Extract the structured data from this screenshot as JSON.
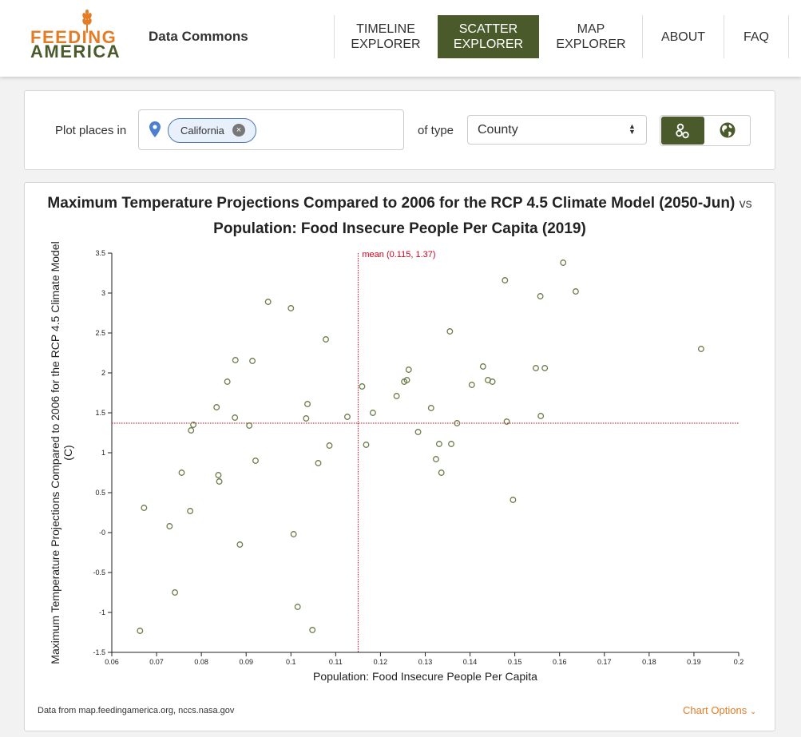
{
  "header": {
    "logo_top": "FEEDING",
    "logo_bottom": "AMERICA",
    "subtitle": "Data Commons",
    "nav": [
      {
        "line1": "TIMELINE",
        "line2": "EXPLORER"
      },
      {
        "line1": "SCATTER",
        "line2": "EXPLORER"
      },
      {
        "line1": "MAP",
        "line2": "EXPLORER"
      },
      {
        "line1": "ABOUT",
        "line2": ""
      },
      {
        "line1": "FAQ",
        "line2": ""
      }
    ],
    "active_nav": "SCATTER EXPLORER"
  },
  "filters": {
    "plot_label": "Plot places in",
    "place_chip": "California",
    "chip_close": "×",
    "type_label": "of type",
    "type_value": "County",
    "toggle_icons": [
      "scatter-icon",
      "globe-icon"
    ]
  },
  "chart_title": {
    "part1": "Maximum Temperature Projections Compared to 2006 for the RCP 4.5 Climate Model (2050-Jun)",
    "vs": "vs",
    "part2": "Population: Food Insecure People Per Capita (2019)"
  },
  "footer": {
    "source": "Data from map.feedingamerica.org, nccs.nasa.gov",
    "chart_options": "Chart Options"
  },
  "colors": {
    "brand_orange": "#e37c25",
    "brand_green": "#4a5a2b",
    "point": "#6b7d49",
    "mean_line": "#d0021b"
  },
  "chart_data": {
    "type": "scatter",
    "xlabel": "Population: Food Insecure People Per Capita",
    "ylabel": "Maximum Temperature Projections Compared to 2006 for the RCP 4.5 Climate Model (C)",
    "xlim": [
      0.06,
      0.2
    ],
    "ylim": [
      -1.5,
      3.5
    ],
    "x_ticks": [
      "0.06",
      "0.07",
      "0.08",
      "0.09",
      "0.1",
      "0.11",
      "0.12",
      "0.13",
      "0.14",
      "0.15",
      "0.16",
      "0.17",
      "0.18",
      "0.19",
      "0.2"
    ],
    "y_ticks": [
      "-1.5",
      "-1",
      "-0.5",
      "-0",
      "0.5",
      "1",
      "1.5",
      "2",
      "2.5",
      "3",
      "3.5"
    ],
    "mean": {
      "x": 0.115,
      "y": 1.37,
      "label": "mean (0.115, 1.37)"
    },
    "points": [
      [
        0.0663,
        -1.23
      ],
      [
        0.0672,
        0.31
      ],
      [
        0.0729,
        0.08
      ],
      [
        0.0741,
        -0.75
      ],
      [
        0.0756,
        0.75
      ],
      [
        0.0775,
        0.27
      ],
      [
        0.0777,
        1.28
      ],
      [
        0.0782,
        1.35
      ],
      [
        0.0834,
        1.57
      ],
      [
        0.0838,
        0.72
      ],
      [
        0.084,
        0.64
      ],
      [
        0.0858,
        1.89
      ],
      [
        0.0875,
        1.44
      ],
      [
        0.0876,
        2.16
      ],
      [
        0.0886,
        -0.15
      ],
      [
        0.0907,
        1.34
      ],
      [
        0.0914,
        2.15
      ],
      [
        0.0921,
        0.9
      ],
      [
        0.0949,
        2.89
      ],
      [
        0.1,
        2.81
      ],
      [
        0.1006,
        -0.02
      ],
      [
        0.1015,
        -0.93
      ],
      [
        0.1034,
        1.43
      ],
      [
        0.1037,
        1.61
      ],
      [
        0.1048,
        -1.22
      ],
      [
        0.1061,
        0.87
      ],
      [
        0.1078,
        2.42
      ],
      [
        0.1086,
        1.09
      ],
      [
        0.1126,
        1.45
      ],
      [
        0.1159,
        1.83
      ],
      [
        0.1168,
        1.1
      ],
      [
        0.1183,
        1.5
      ],
      [
        0.1236,
        1.71
      ],
      [
        0.1253,
        1.89
      ],
      [
        0.1259,
        1.91
      ],
      [
        0.1263,
        2.04
      ],
      [
        0.1284,
        1.26
      ],
      [
        0.1313,
        1.56
      ],
      [
        0.1324,
        0.92
      ],
      [
        0.1331,
        1.11
      ],
      [
        0.1336,
        0.75
      ],
      [
        0.1355,
        2.52
      ],
      [
        0.1358,
        1.11
      ],
      [
        0.1371,
        1.37
      ],
      [
        0.1404,
        1.85
      ],
      [
        0.1429,
        2.08
      ],
      [
        0.144,
        1.91
      ],
      [
        0.145,
        1.89
      ],
      [
        0.1478,
        3.16
      ],
      [
        0.1482,
        1.39
      ],
      [
        0.1496,
        0.41
      ],
      [
        0.1547,
        2.06
      ],
      [
        0.1557,
        2.96
      ],
      [
        0.1558,
        1.46
      ],
      [
        0.1567,
        2.06
      ],
      [
        0.1608,
        3.38
      ],
      [
        0.1636,
        3.02
      ],
      [
        0.1916,
        2.3
      ]
    ]
  }
}
